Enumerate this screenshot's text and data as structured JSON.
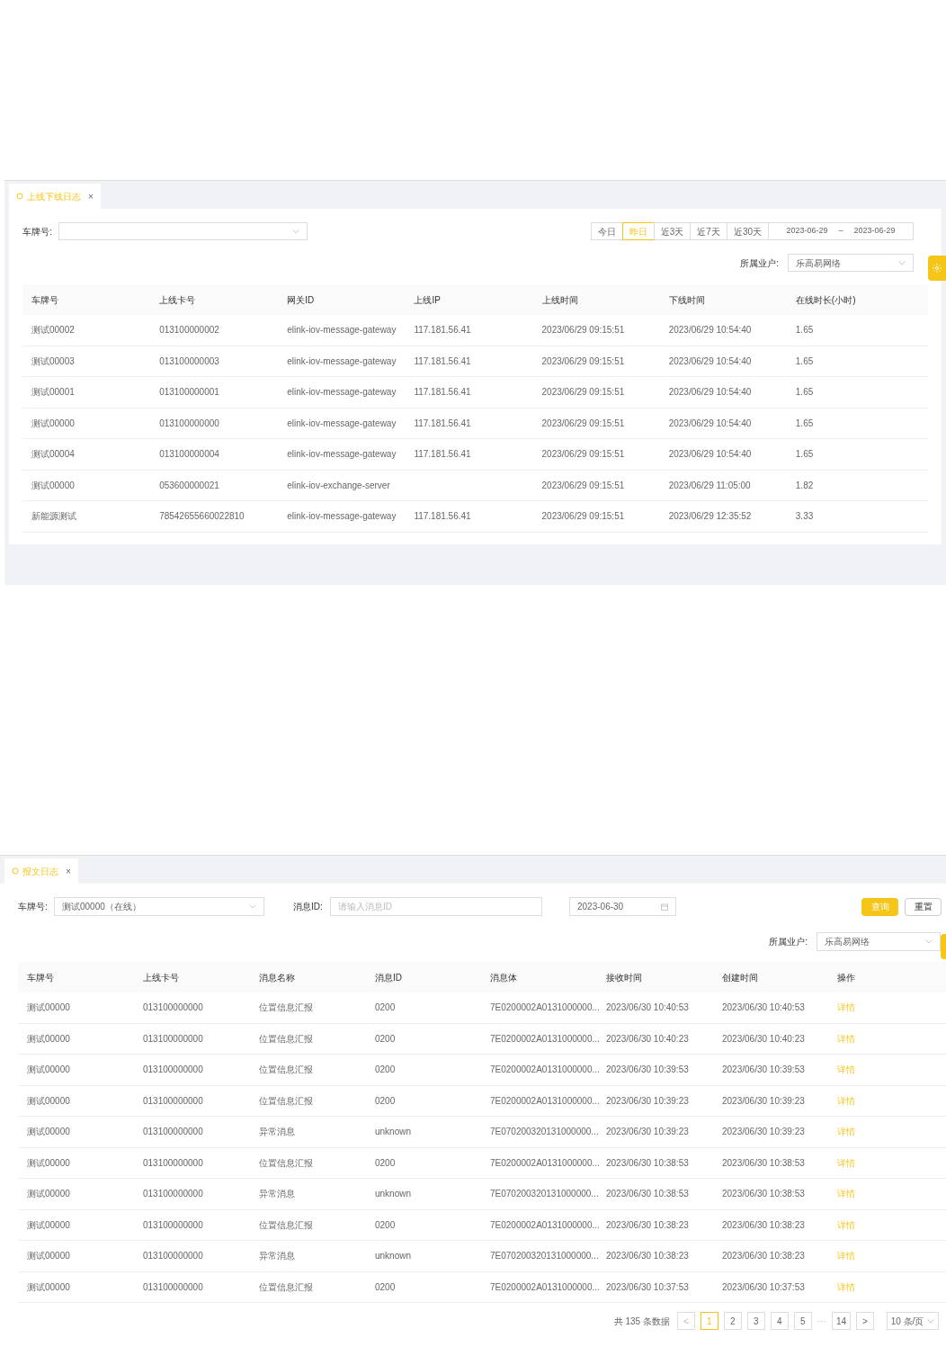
{
  "online_log": {
    "tab": {
      "label": "上线下线日志",
      "close": "×",
      "selected": true
    },
    "filters": {
      "plate_label": "车牌号:",
      "ranges": [
        {
          "label": "今日",
          "selected": false
        },
        {
          "label": "昨日",
          "selected": true
        },
        {
          "label": "近3天",
          "selected": false
        },
        {
          "label": "近7天",
          "selected": false
        },
        {
          "label": "近30天",
          "selected": false
        }
      ],
      "date_start": "2023-06-29",
      "date_sep": "–",
      "date_end": "2023-06-29",
      "tenant_label": "所属业户:",
      "tenant_value": "乐高易网络"
    },
    "table": {
      "columns": [
        "车牌号",
        "上线卡号",
        "网关ID",
        "上线IP",
        "上线时间",
        "下线时间",
        "在线时长(小时)"
      ],
      "rows": [
        [
          "测试00002",
          "013100000002",
          "elink-iov-message-gateway",
          "117.181.56.41",
          "2023/06/29 09:15:51",
          "2023/06/29 10:54:40",
          "1.65"
        ],
        [
          "测试00003",
          "013100000003",
          "elink-iov-message-gateway",
          "117.181.56.41",
          "2023/06/29 09:15:51",
          "2023/06/29 10:54:40",
          "1.65"
        ],
        [
          "测试00001",
          "013100000001",
          "elink-iov-message-gateway",
          "117.181.56.41",
          "2023/06/29 09:15:51",
          "2023/06/29 10:54:40",
          "1.65"
        ],
        [
          "测试00000",
          "013100000000",
          "elink-iov-message-gateway",
          "117.181.56.41",
          "2023/06/29 09:15:51",
          "2023/06/29 10:54:40",
          "1.65"
        ],
        [
          "测试00004",
          "013100000004",
          "elink-iov-message-gateway",
          "117.181.56.41",
          "2023/06/29 09:15:51",
          "2023/06/29 10:54:40",
          "1.65"
        ],
        [
          "测试00000",
          "053600000021",
          "elink-iov-exchange-server",
          "",
          "2023/06/29 09:15:51",
          "2023/06/29 11:05:00",
          "1.82"
        ],
        [
          "新能源测试",
          "78542655660022810",
          "elink-iov-message-gateway",
          "117.181.56.41",
          "2023/06/29 09:15:51",
          "2023/06/29 12:35:52",
          "3.33"
        ]
      ]
    }
  },
  "message_log": {
    "tab": {
      "label": "报文日志",
      "close": "×",
      "selected": true
    },
    "filters": {
      "plate_label": "车牌号:",
      "plate_value": "测试00000（在线）",
      "msg_label": "消息ID:",
      "msg_placeholder": "请输入消息ID",
      "date": "2023-06-30",
      "query": "查询",
      "reset": "重置",
      "tenant_label": "所属业户:",
      "tenant_value": "乐高易网络"
    },
    "table": {
      "columns": [
        "车牌号",
        "上线卡号",
        "消息名称",
        "消息ID",
        "消息体",
        "接收时间",
        "创建时间",
        "操作"
      ],
      "rows": [
        [
          "测试00000",
          "013100000000",
          "位置信息汇报",
          "0200",
          "7E0200002A0131000000...",
          "2023/06/30 10:40:53",
          "2023/06/30 10:40:53",
          "详情"
        ],
        [
          "测试00000",
          "013100000000",
          "位置信息汇报",
          "0200",
          "7E0200002A0131000000...",
          "2023/06/30 10:40:23",
          "2023/06/30 10:40:23",
          "详情"
        ],
        [
          "测试00000",
          "013100000000",
          "位置信息汇报",
          "0200",
          "7E0200002A0131000000...",
          "2023/06/30 10:39:53",
          "2023/06/30 10:39:53",
          "详情"
        ],
        [
          "测试00000",
          "013100000000",
          "位置信息汇报",
          "0200",
          "7E0200002A0131000000...",
          "2023/06/30 10:39:23",
          "2023/06/30 10:39:23",
          "详情"
        ],
        [
          "测试00000",
          "013100000000",
          "异常消息",
          "unknown",
          "7E070200320131000000...",
          "2023/06/30 10:39:23",
          "2023/06/30 10:39:23",
          "详情"
        ],
        [
          "测试00000",
          "013100000000",
          "位置信息汇报",
          "0200",
          "7E0200002A0131000000...",
          "2023/06/30 10:38:53",
          "2023/06/30 10:38:53",
          "详情"
        ],
        [
          "测试00000",
          "013100000000",
          "异常消息",
          "unknown",
          "7E070200320131000000...",
          "2023/06/30 10:38:53",
          "2023/06/30 10:38:53",
          "详情"
        ],
        [
          "测试00000",
          "013100000000",
          "位置信息汇报",
          "0200",
          "7E0200002A0131000000...",
          "2023/06/30 10:38:23",
          "2023/06/30 10:38:23",
          "详情"
        ],
        [
          "测试00000",
          "013100000000",
          "异常消息",
          "unknown",
          "7E070200320131000000...",
          "2023/06/30 10:38:23",
          "2023/06/30 10:38:23",
          "详情"
        ],
        [
          "测试00000",
          "013100000000",
          "位置信息汇报",
          "0200",
          "7E0200002A0131000000...",
          "2023/06/30 10:37:53",
          "2023/06/30 10:37:53",
          "详情"
        ]
      ]
    },
    "pagination": {
      "total": "共 135 条数据",
      "prev": "<",
      "pages": [
        {
          "label": "1",
          "selected": true
        },
        {
          "label": "2",
          "selected": false
        },
        {
          "label": "3",
          "selected": false
        },
        {
          "label": "4",
          "selected": false
        },
        {
          "label": "5",
          "selected": false
        }
      ],
      "ellipsis": "···",
      "last": "14",
      "next": ">",
      "page_size": "10 条/页"
    }
  }
}
